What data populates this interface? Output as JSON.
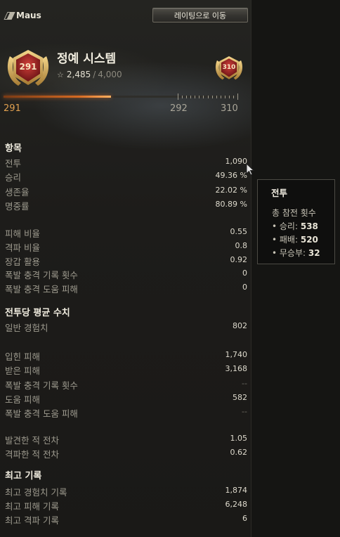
{
  "tank": {
    "name": "Maus",
    "tier_icon": "tier-chevron-icon"
  },
  "header": {
    "rating_button": "레이팅으로 이동"
  },
  "elite": {
    "title": "정예 시스템",
    "current_level": "291",
    "next_badge": "310",
    "xp_current": "2,485",
    "xp_separator": "/",
    "xp_max": "4,000",
    "progress_fraction": 0.46,
    "levels": {
      "current": "291",
      "mid": "292",
      "end": "310"
    },
    "badge_color": "#a3262a",
    "accent": "#d66a22"
  },
  "sections": {
    "items": {
      "title": "항목",
      "rows": [
        {
          "label": "전투",
          "value": "1,090"
        },
        {
          "label": "승리",
          "value": "49.36 %"
        },
        {
          "label": "생존율",
          "value": "22.02 %"
        },
        {
          "label": "명중률",
          "value": "80.89 %"
        }
      ],
      "rows2": [
        {
          "label": "피해 비율",
          "value": "0.55"
        },
        {
          "label": "격파 비율",
          "value": "0.8"
        },
        {
          "label": "장갑 활용",
          "value": "0.92"
        },
        {
          "label": "폭발 충격 기록 횟수",
          "value": "0"
        },
        {
          "label": "폭발 충격 도움 피해",
          "value": "0"
        }
      ]
    },
    "average": {
      "title": "전투당 평균 수치",
      "rows": [
        {
          "label": "일반 경험치",
          "value": "802"
        }
      ],
      "rows2": [
        {
          "label": "입힌 피해",
          "value": "1,740"
        },
        {
          "label": "받은 피해",
          "value": "3,168"
        },
        {
          "label": "폭발 충격 기록 횟수",
          "value": "--"
        },
        {
          "label": "도움 피해",
          "value": "582"
        },
        {
          "label": "폭발 충격 도움 피해",
          "value": "--"
        }
      ],
      "rows3": [
        {
          "label": "발견한 적 전차",
          "value": "1.05"
        },
        {
          "label": "격파한 적 전차",
          "value": "0.62"
        }
      ]
    },
    "records": {
      "title": "최고 기록",
      "rows": [
        {
          "label": "최고 경험치 기록",
          "value": "1,874"
        },
        {
          "label": "최고 피해 기록",
          "value": "6,248"
        },
        {
          "label": "최고 격파 기록",
          "value": "6"
        }
      ]
    }
  },
  "tooltip": {
    "title": "전투",
    "subtitle": "총 참전 횟수",
    "items": [
      {
        "label": "• 승리:",
        "value": "538"
      },
      {
        "label": "• 패배:",
        "value": "520"
      },
      {
        "label": "• 무승부:",
        "value": "32"
      }
    ]
  }
}
